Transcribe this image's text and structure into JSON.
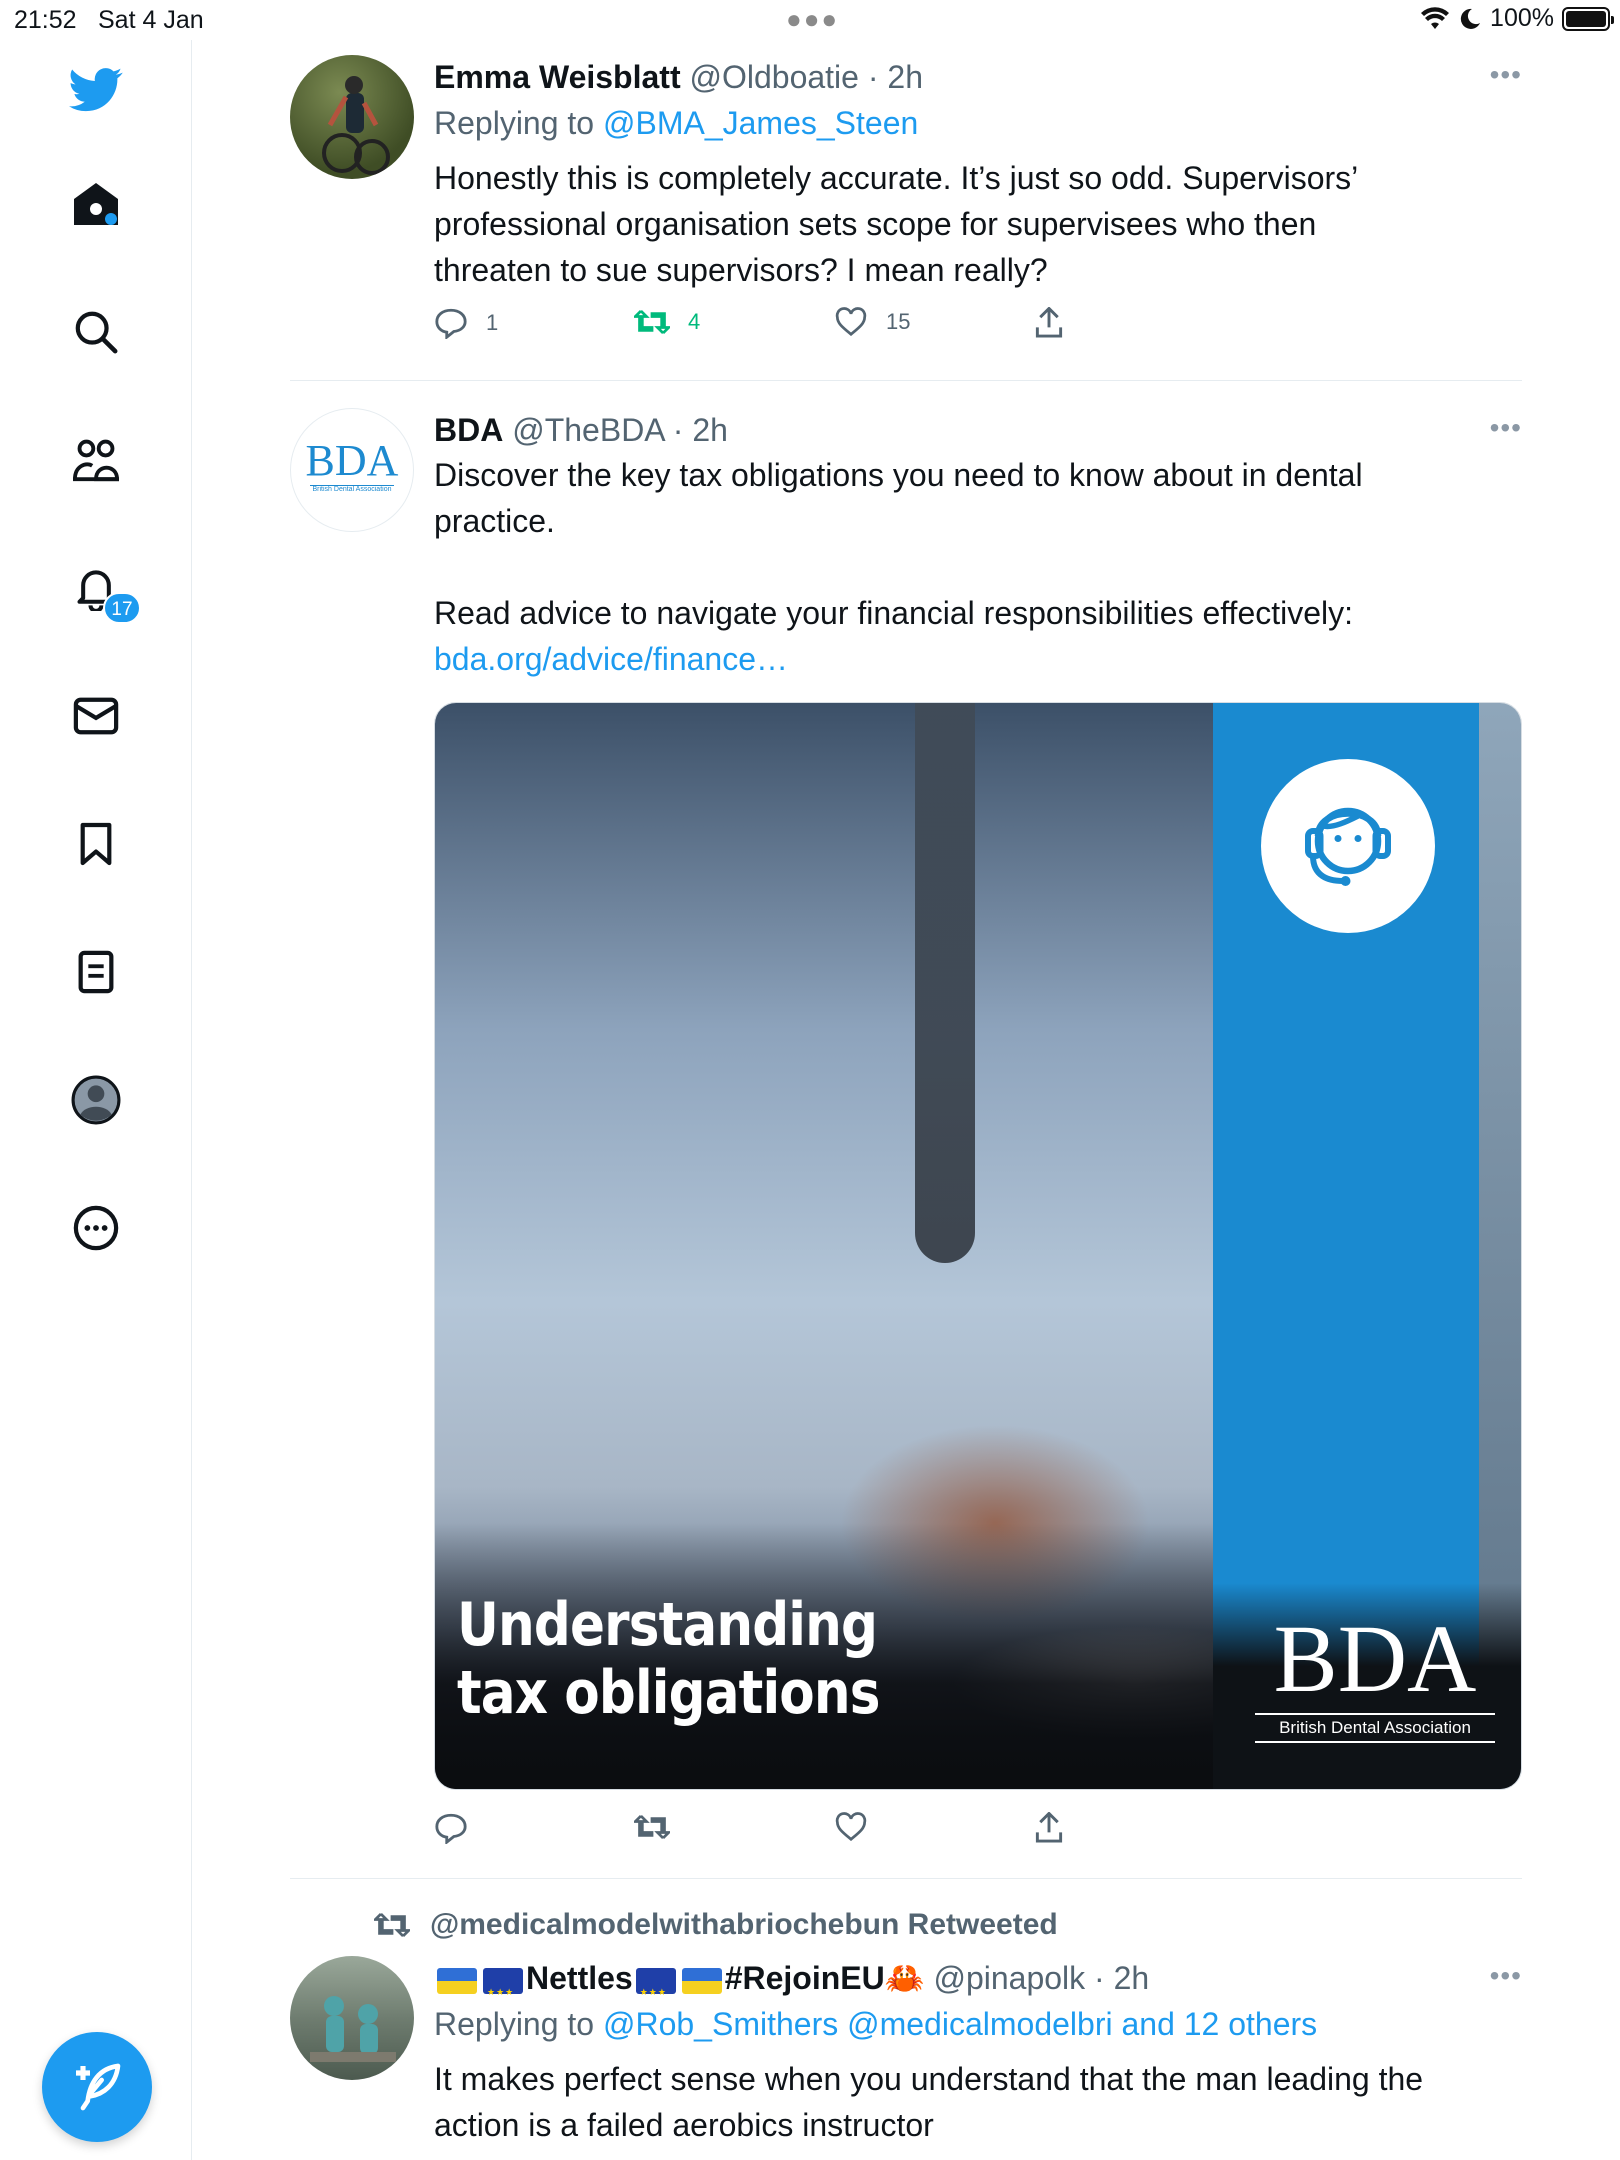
{
  "status": {
    "time": "21:52",
    "date": "Sat 4 Jan",
    "battery": "100%",
    "badge_count": "17"
  },
  "sidebar": {
    "items": [
      {
        "name": "home"
      },
      {
        "name": "search"
      },
      {
        "name": "communities"
      },
      {
        "name": "notifications"
      },
      {
        "name": "messages"
      },
      {
        "name": "bookmarks"
      },
      {
        "name": "lists"
      },
      {
        "name": "profile"
      },
      {
        "name": "more"
      }
    ],
    "compose_icon": "compose-icon"
  },
  "tweets": [
    {
      "name": "Emma Weisblatt",
      "handle": "@Oldboatie",
      "time": "· 2h",
      "reply_prefix": "Replying to",
      "reply_to": "@BMA_James_Steen",
      "text_line1": "Honestly this is completely accurate. It’s just so odd. Supervisors’",
      "text_line2": "professional  organisation sets scope for supervisees who then",
      "text_line3": "threaten to sue supervisors? I mean really?",
      "replies": "1",
      "retweets": "4",
      "likes": "15"
    },
    {
      "name": "BDA",
      "handle": "@TheBDA",
      "time": "· 2h",
      "avatar_text": "BDA",
      "avatar_subtext": "British Dental Association",
      "text_line1": "Discover the key tax obligations you need to know about in dental",
      "text_line2": "practice.",
      "text_line3": "Read advice to navigate your financial responsibilities effectively:",
      "link": "bda.org/advice/finance…",
      "media_title_line1": "Understanding",
      "media_title_line2": "tax obligations",
      "media_logo": "BDA",
      "media_logo_sub": "British Dental Association"
    },
    {
      "retweeted_by": "@medicalmodelwithabriochebun Retweeted",
      "name_part1": "Nettles",
      "name_part2": "#RejoinEU",
      "crab": "🦀",
      "handle": "@pinapolk",
      "time": "· 2h",
      "reply_prefix": "Replying to",
      "reply_to": "@Rob_Smithers @medicalmodelbri and 12 others",
      "text_line1": "It makes perfect sense when you understand that the man leading the",
      "text_line2": "action is a failed aerobics instructor"
    }
  ]
}
